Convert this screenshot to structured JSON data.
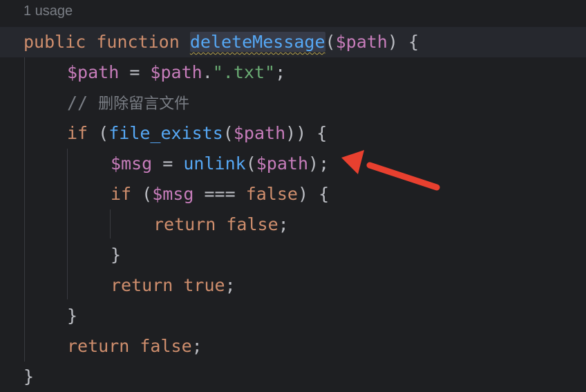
{
  "usage_hint": "1 usage",
  "code": {
    "line1": {
      "public": "public",
      "function": "function",
      "name": "deleteMessage",
      "open_paren": "(",
      "param": "$path",
      "close": ") {"
    },
    "line2": {
      "var": "$path",
      "assign": " = ",
      "var2": "$path",
      "dot": ".",
      "str": "\".txt\"",
      "semi": ";"
    },
    "line3": {
      "comment_slashes": "// ",
      "comment_text": "删除留言文件"
    },
    "line4": {
      "if": "if",
      "open": " (",
      "fn": "file_exists",
      "paren": "(",
      "var": "$path",
      "close": ")) {"
    },
    "line5": {
      "var": "$msg",
      "assign": " = ",
      "fn": "unlink",
      "paren": "(",
      "var2": "$path",
      "close": ");"
    },
    "line6": {
      "if": "if",
      "open": " (",
      "var": "$msg",
      "op": " === ",
      "false": "false",
      "close": ") {"
    },
    "line7": {
      "return": "return",
      "sp": " ",
      "false": "false",
      "semi": ";"
    },
    "line8": {
      "brace": "}"
    },
    "line9": {
      "return": "return",
      "sp": " ",
      "true": "true",
      "semi": ";"
    },
    "line10": {
      "brace": "}"
    },
    "line11": {
      "return": "return",
      "sp": " ",
      "false": "false",
      "semi": ";"
    },
    "line12": {
      "brace": "}"
    }
  },
  "annotation": {
    "icon": "red-arrow-icon",
    "color": "#e8402f"
  },
  "theme": {
    "background": "#1e1f22",
    "keyword": "#cf8e6d",
    "function": "#56a8f5",
    "variable": "#c77dbb",
    "string": "#6aab73",
    "comment": "#7a7e85",
    "text": "#bcbec4"
  }
}
